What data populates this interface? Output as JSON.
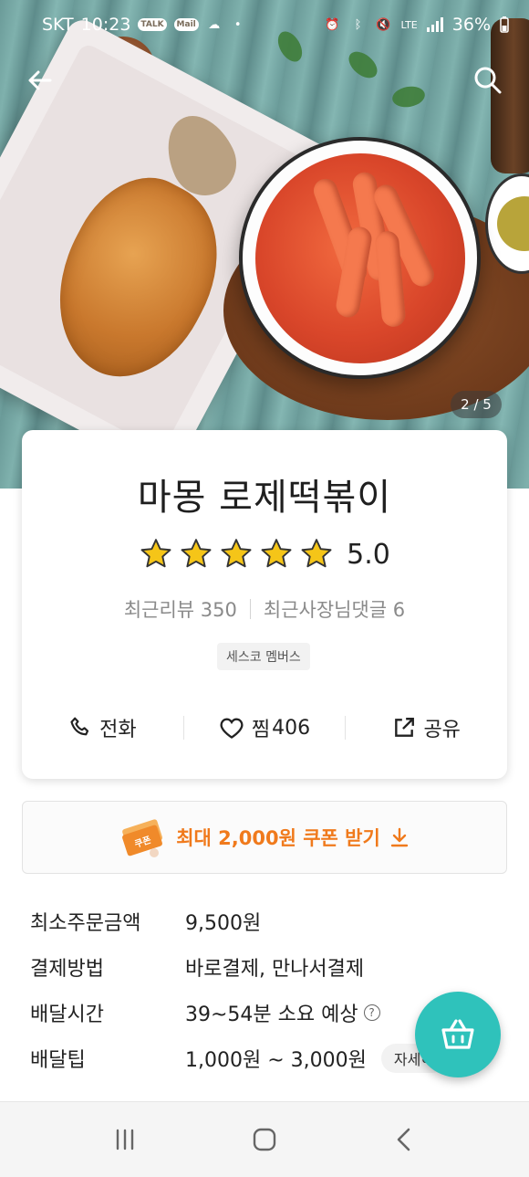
{
  "status_bar": {
    "carrier": "SKT",
    "time": "10:23",
    "notif_chips": [
      "TALK",
      "Mail"
    ],
    "network": "LTE",
    "battery": "36%"
  },
  "gallery": {
    "indicator": "2 / 5"
  },
  "store": {
    "name": "마몽 로제떡볶이",
    "rating": "5.0",
    "stars": 5,
    "recent_reviews_label": "최근리뷰 350",
    "recent_owner_comments_label": "최근사장님댓글 6",
    "badge": "세스코 멤버스"
  },
  "actions": {
    "call_label": "전화",
    "favorite_label": "찜",
    "favorite_count": "406",
    "share_label": "공유"
  },
  "coupon": {
    "icon_text": "쿠폰",
    "label": "최대 2,000원 쿠폰 받기"
  },
  "details": {
    "min_order_label": "최소주문금액",
    "min_order_value": "9,500원",
    "payment_label": "결제방법",
    "payment_value": "바로결제, 만나서결제",
    "delivery_time_label": "배달시간",
    "delivery_time_value": "39~54분 소요 예상",
    "delivery_tip_label": "배달팁",
    "delivery_tip_value": "1,000원 ~ 3,000원",
    "detail_button": "자세히"
  },
  "colors": {
    "accent_orange": "#f07a1c",
    "cart_teal": "#2fc2bb",
    "star_yellow": "#f5c518"
  },
  "icons": {
    "back": "arrow-left-icon",
    "search": "search-icon",
    "call": "phone-icon",
    "favorite": "heart-icon",
    "share": "share-icon",
    "coupon": "coupon-icon",
    "download": "download-arrow-icon",
    "help": "question-circle-icon",
    "cart": "basket-icon",
    "nav_recent": "recent-apps-icon",
    "nav_home": "home-icon",
    "nav_back": "nav-back-icon"
  }
}
